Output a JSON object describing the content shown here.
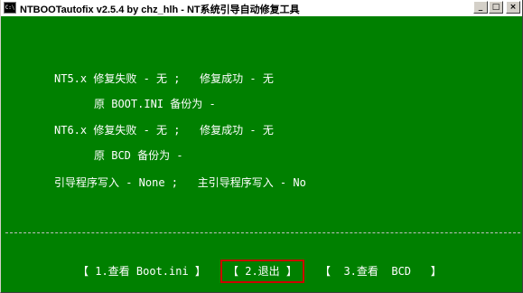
{
  "window": {
    "title": "NTBOOTautofix v2.5.4 by chz_hlh - NT系统引导自动修复工具",
    "icon_text": "C:\\"
  },
  "controls": {
    "minimize": "_",
    "maximize": "□",
    "close": "×"
  },
  "report": {
    "nt5_line": "NT5.x 修复失败 - 无 ;   修复成功 - 无",
    "nt5_backup": "原 BOOT.INI 备份为 -",
    "nt6_line": "NT6.x 修复失败 - 无 ;   修复成功 - 无",
    "nt6_backup": "原 BCD 备份为 -",
    "boot_write": "引导程序写入 - None ;   主引导程序写入 - No"
  },
  "menu": {
    "items": [
      {
        "label": "【 1.查看 Boot.ini 】"
      },
      {
        "label": "【 2.退出 】"
      },
      {
        "label": "【  3.查看  BCD   】"
      }
    ]
  },
  "colors": {
    "background": "#008000",
    "text": "#ffffff",
    "highlight_border": "#cc0000"
  }
}
